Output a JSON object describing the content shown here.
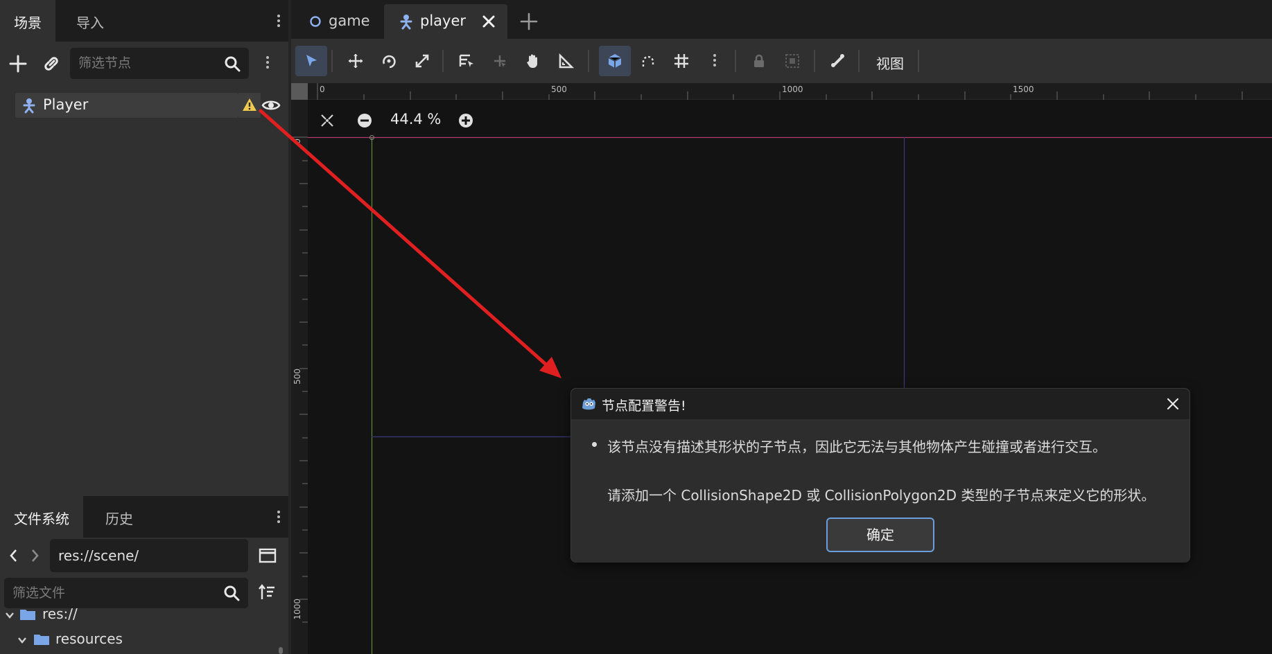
{
  "scene_dock": {
    "tabs": [
      {
        "label": "场景"
      },
      {
        "label": "导入"
      }
    ],
    "filter_placeholder": "筛选节点",
    "tree": [
      {
        "label": "Player",
        "warning": true,
        "visible": true
      }
    ]
  },
  "fs_dock": {
    "tabs": [
      {
        "label": "文件系统"
      },
      {
        "label": "历史"
      }
    ],
    "path": "res://scene/",
    "filter_placeholder": "筛选文件",
    "tree": [
      {
        "label": "res://"
      },
      {
        "label": "resources"
      }
    ]
  },
  "editor_tabs": [
    {
      "label": "game"
    },
    {
      "label": "player"
    }
  ],
  "toolbar": {
    "view_label": "视图"
  },
  "rulers": {
    "top": [
      "0",
      "500",
      "1000",
      "1500"
    ],
    "left": [
      "0",
      "500",
      "1000"
    ]
  },
  "zoom": {
    "value": "44.4 %"
  },
  "dialog": {
    "title": "节点配置警告!",
    "line1": "该节点没有描述其形状的子节点，因此它无法与其他物体产生碰撞或者进行交互。",
    "line2": "请添加一个 CollisionShape2D 或 CollisionPolygon2D 类型的子节点来定义它的形状。",
    "ok_label": "确定"
  },
  "colors": {
    "accent": "#6b9ddf",
    "warning": "#f0c94f",
    "annotation_arrow": "#e02020"
  }
}
